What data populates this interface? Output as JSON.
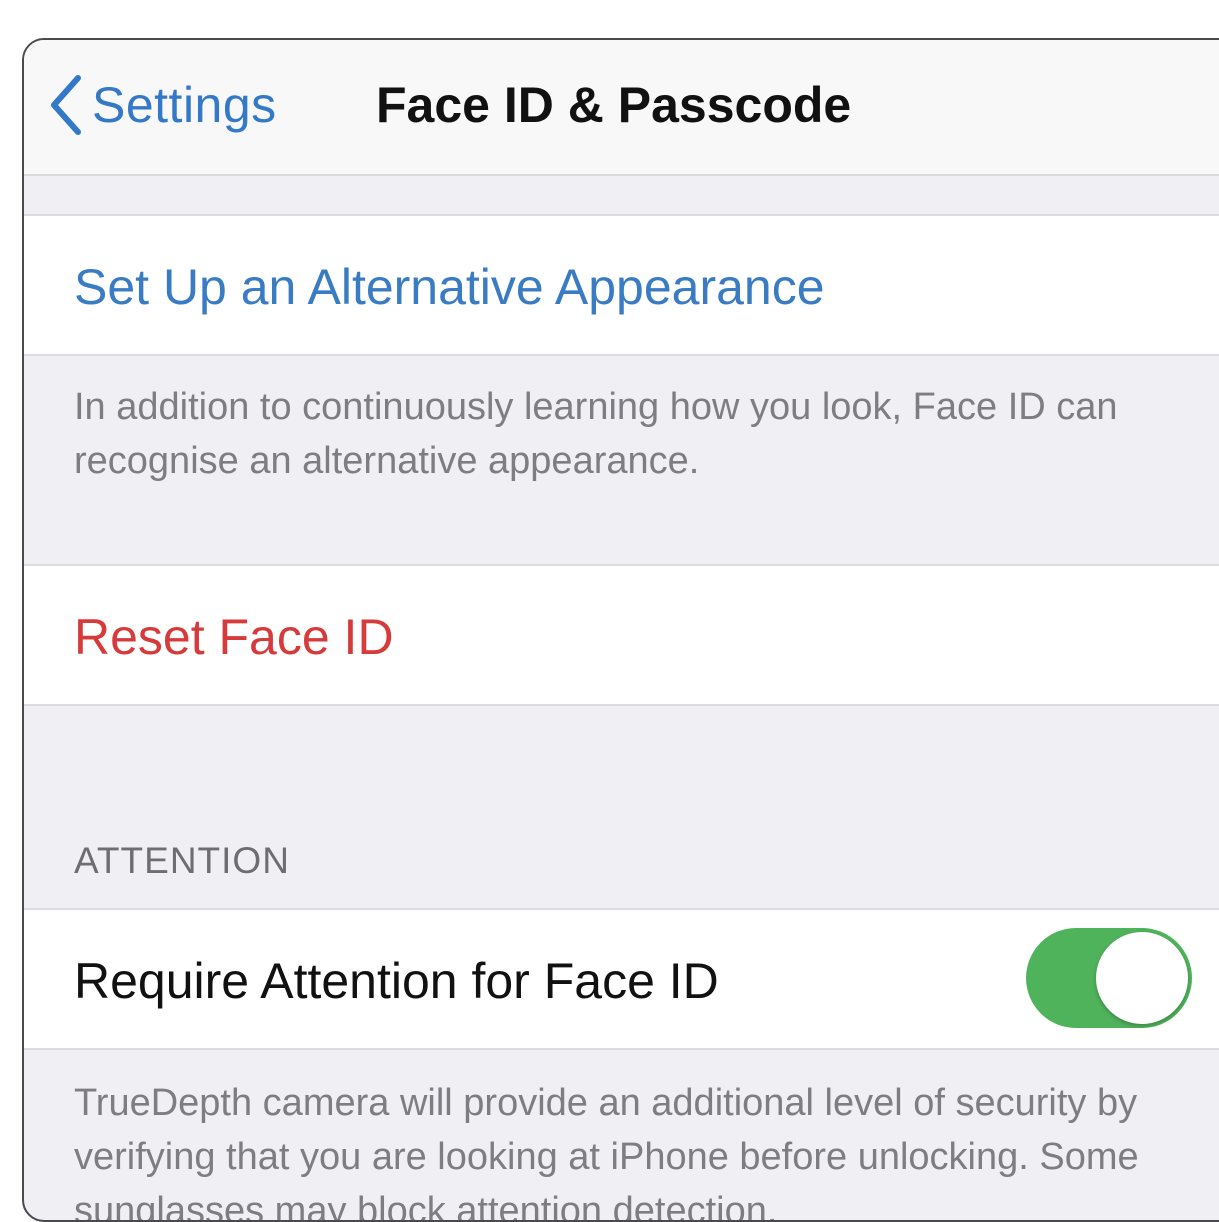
{
  "navbar": {
    "back_label": "Settings",
    "title": "Face ID & Passcode"
  },
  "alternative": {
    "action_label": "Set Up an Alternative Appearance",
    "footer": "In addition to continuously learning how you look, Face ID can recognise an alternative appearance."
  },
  "reset": {
    "action_label": "Reset Face ID"
  },
  "attention": {
    "section_header": "ATTENTION",
    "toggle_label": "Require Attention for Face ID",
    "toggle_on": true,
    "footer": "TrueDepth camera will provide an additional level of security by verifying that you are looking at iPhone before unlocking. Some sunglasses may block attention detection."
  },
  "colors": {
    "accent": "#3a7cc4",
    "destructive": "#d63a3a",
    "toggle_on": "#4fb35b"
  }
}
